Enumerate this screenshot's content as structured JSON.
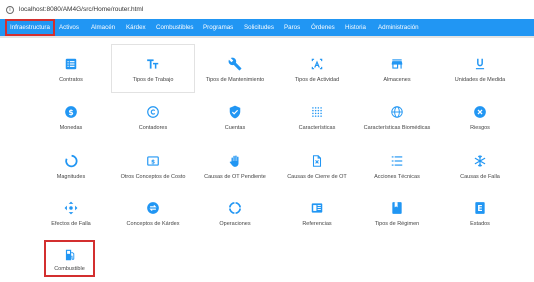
{
  "browser": {
    "url": "localhost:8080/AM4G/src/Home/router.html"
  },
  "nav": {
    "items": [
      "Infraestructura",
      "Activos",
      "Almacén",
      "Kárdex",
      "Combustibles",
      "Programas",
      "Solicitudes",
      "Paros",
      "Órdenes",
      "Historia",
      "Administración"
    ],
    "active": "Infraestructura"
  },
  "tiles": [
    {
      "label": "Contratos",
      "icon": "list-alt-icon"
    },
    {
      "label": "Tipos de Trabajo",
      "icon": "text-format-icon"
    },
    {
      "label": "Tipos de Mantenimiento",
      "icon": "wrench-icon"
    },
    {
      "label": "Tipos de Actividad",
      "icon": "letter-a-frame-icon"
    },
    {
      "label": "Almacenes",
      "icon": "store-icon"
    },
    {
      "label": "Unidades de Medida",
      "icon": "underline-u-icon"
    },
    {
      "label": "Monedas",
      "icon": "dollar-circle-icon"
    },
    {
      "label": "Contadores",
      "icon": "copyright-c-icon"
    },
    {
      "label": "Cuentas",
      "icon": "verified-shield-icon"
    },
    {
      "label": "Características",
      "icon": "dots-grid-icon"
    },
    {
      "label": "Características Biomédicas",
      "icon": "globe-icon"
    },
    {
      "label": "Riesgos",
      "icon": "cancel-circle-icon"
    },
    {
      "label": "Magnitudes",
      "icon": "progress-circle-icon"
    },
    {
      "label": "Otros Conceptos de Costo",
      "icon": "dollar-box-icon"
    },
    {
      "label": "Causas de OT Pendiente",
      "icon": "hand-icon"
    },
    {
      "label": "Causas de Cierre de OT",
      "icon": "document-x-icon"
    },
    {
      "label": "Acciones Técnicas",
      "icon": "format-list-icon"
    },
    {
      "label": "Causas de Falla",
      "icon": "snowflake-icon"
    },
    {
      "label": "Efectos de Falla",
      "icon": "move-arrows-icon"
    },
    {
      "label": "Conceptos de Kárdex",
      "icon": "swap-circle-icon"
    },
    {
      "label": "Operaciones",
      "icon": "circle-arrows-icon"
    },
    {
      "label": "Referencias",
      "icon": "book-open-icon"
    },
    {
      "label": "Tipos de Régimen",
      "icon": "bookmark-box-icon"
    },
    {
      "label": "Estados",
      "icon": "letter-e-box-icon"
    },
    {
      "label": "Combustible",
      "icon": "fuel-pump-icon"
    }
  ],
  "colors": {
    "nav_bg": "#2196f3",
    "icon": "#2196f3",
    "highlight": "#d32f2f",
    "label": "#444444"
  }
}
